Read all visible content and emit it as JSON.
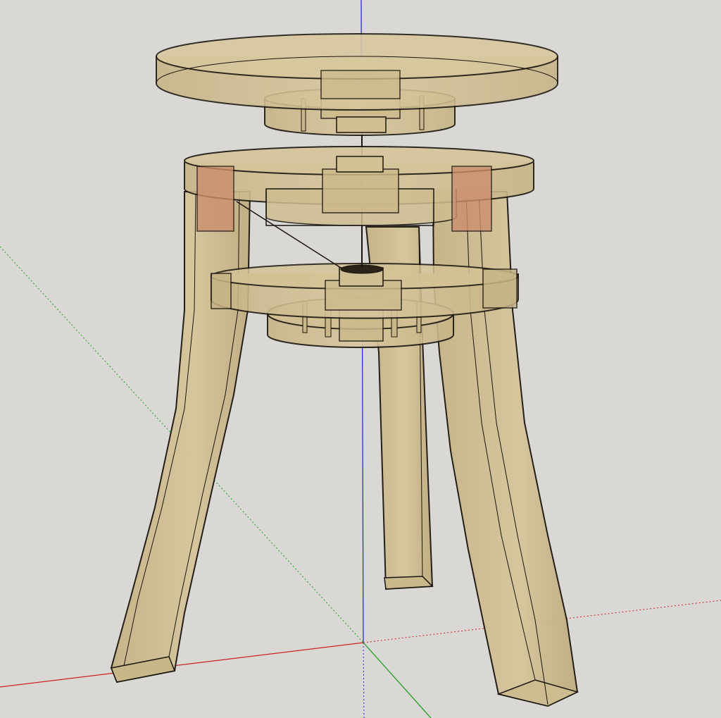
{
  "viewport": {
    "background": "#dad8d4",
    "wood_color": "#d2c094",
    "wood_dark": "#b9a679",
    "edge_color": "#1a160e",
    "pad_color": "#c9866a"
  },
  "axes": {
    "x_axis_color": "#cc2222",
    "y_axis_color": "#1f9a1f",
    "z_axis_color": "#2020cc"
  },
  "model": {
    "parts": [
      "seat-top",
      "seat-hub-plate",
      "upper-ring",
      "lower-ring",
      "lower-hub-plate",
      "leg-left",
      "leg-back",
      "leg-right",
      "center-screw"
    ]
  }
}
